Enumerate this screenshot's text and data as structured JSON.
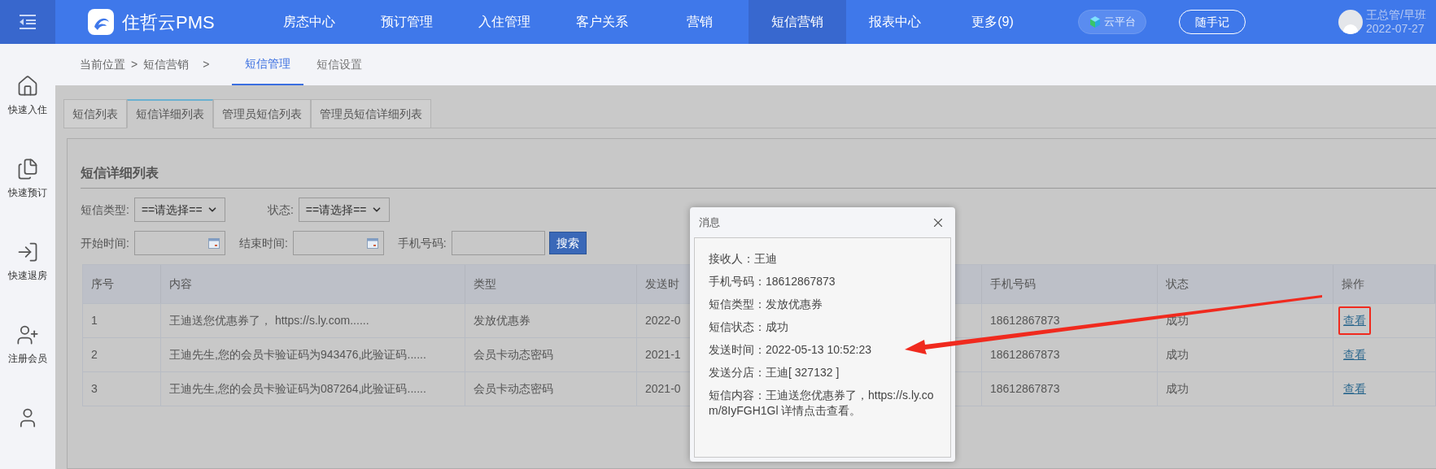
{
  "top_bar": {
    "logo_text": "住哲云PMS",
    "nav": [
      {
        "label": "房态中心",
        "selected": false
      },
      {
        "label": "预订管理",
        "selected": false
      },
      {
        "label": "入住管理",
        "selected": false
      },
      {
        "label": "客户关系",
        "selected": false
      },
      {
        "label": "营销",
        "selected": false
      },
      {
        "label": "短信营销",
        "selected": true
      },
      {
        "label": "报表中心",
        "selected": false
      },
      {
        "label": "更多(9)",
        "selected": false
      }
    ],
    "cloud_button": "云平台",
    "note_button": "随手记",
    "user": {
      "name": "王总管/早班",
      "date": "2022-07-27"
    }
  },
  "sidebar": {
    "items": [
      {
        "kind": "checkin",
        "label": "快速入住"
      },
      {
        "kind": "booking",
        "label": "快速预订"
      },
      {
        "kind": "checkout",
        "label": "快速退房"
      },
      {
        "kind": "member",
        "label": "注册会员"
      },
      {
        "kind": "user"
      }
    ]
  },
  "breadcrumb": [
    "当前位置",
    ">",
    "短信营销",
    ">"
  ],
  "page_tabs": [
    {
      "label": "短信管理",
      "selected": true
    },
    {
      "label": "短信设置",
      "selected": false
    }
  ],
  "sub_tabs": [
    {
      "label": "短信列表",
      "selected": false
    },
    {
      "label": "短信详细列表",
      "selected": true
    },
    {
      "label": "管理员短信列表",
      "selected": false
    },
    {
      "label": "管理员短信详细列表",
      "selected": false
    }
  ],
  "panel": {
    "title": "短信详细列表",
    "filter_rows": [
      [
        {
          "kind": "select",
          "label": "短信类型:",
          "value": "==请选择=="
        },
        {
          "kind": "select",
          "label": "状态:",
          "value": "==请选择=="
        }
      ],
      [
        {
          "kind": "date",
          "label": "开始时间:"
        },
        {
          "kind": "date",
          "label": "结束时间:"
        },
        {
          "kind": "text",
          "label": "手机号码:"
        },
        {
          "kind": "button",
          "label": "搜索"
        }
      ]
    ]
  },
  "table": {
    "columns": [
      "序号",
      "内容",
      "类型",
      "发送时",
      "手机号码",
      "状态",
      "操作"
    ],
    "rows": [
      {
        "cells": [
          "1",
          "王迪送您优惠券了， https://s.ly.com......",
          "发放优惠券",
          "2022-0",
          "18612867873",
          "成功"
        ],
        "action": "查看",
        "highlighted": true
      },
      {
        "cells": [
          "2",
          "王迪先生,您的会员卡验证码为943476,此验证码......",
          "会员卡动态密码",
          "2021-1",
          "18612867873",
          "成功"
        ],
        "action": "查看",
        "highlighted": false
      },
      {
        "cells": [
          "3",
          "王迪先生,您的会员卡验证码为087264,此验证码......",
          "会员卡动态密码",
          "2021-0",
          "18612867873",
          "成功"
        ],
        "action": "查看",
        "highlighted": false
      }
    ]
  },
  "dialog": {
    "title": "消息",
    "lines": [
      "接收人：王迪",
      "手机号码：18612867873",
      "短信类型：发放优惠券",
      "短信状态：成功",
      "发送时间：2022-05-13 10:52:23",
      "发送分店：王迪[ 327132 ]",
      "短信内容：王迪送您优惠券了，https://s.ly.com/8IyFGH1Gl 详情点击查看。"
    ]
  }
}
